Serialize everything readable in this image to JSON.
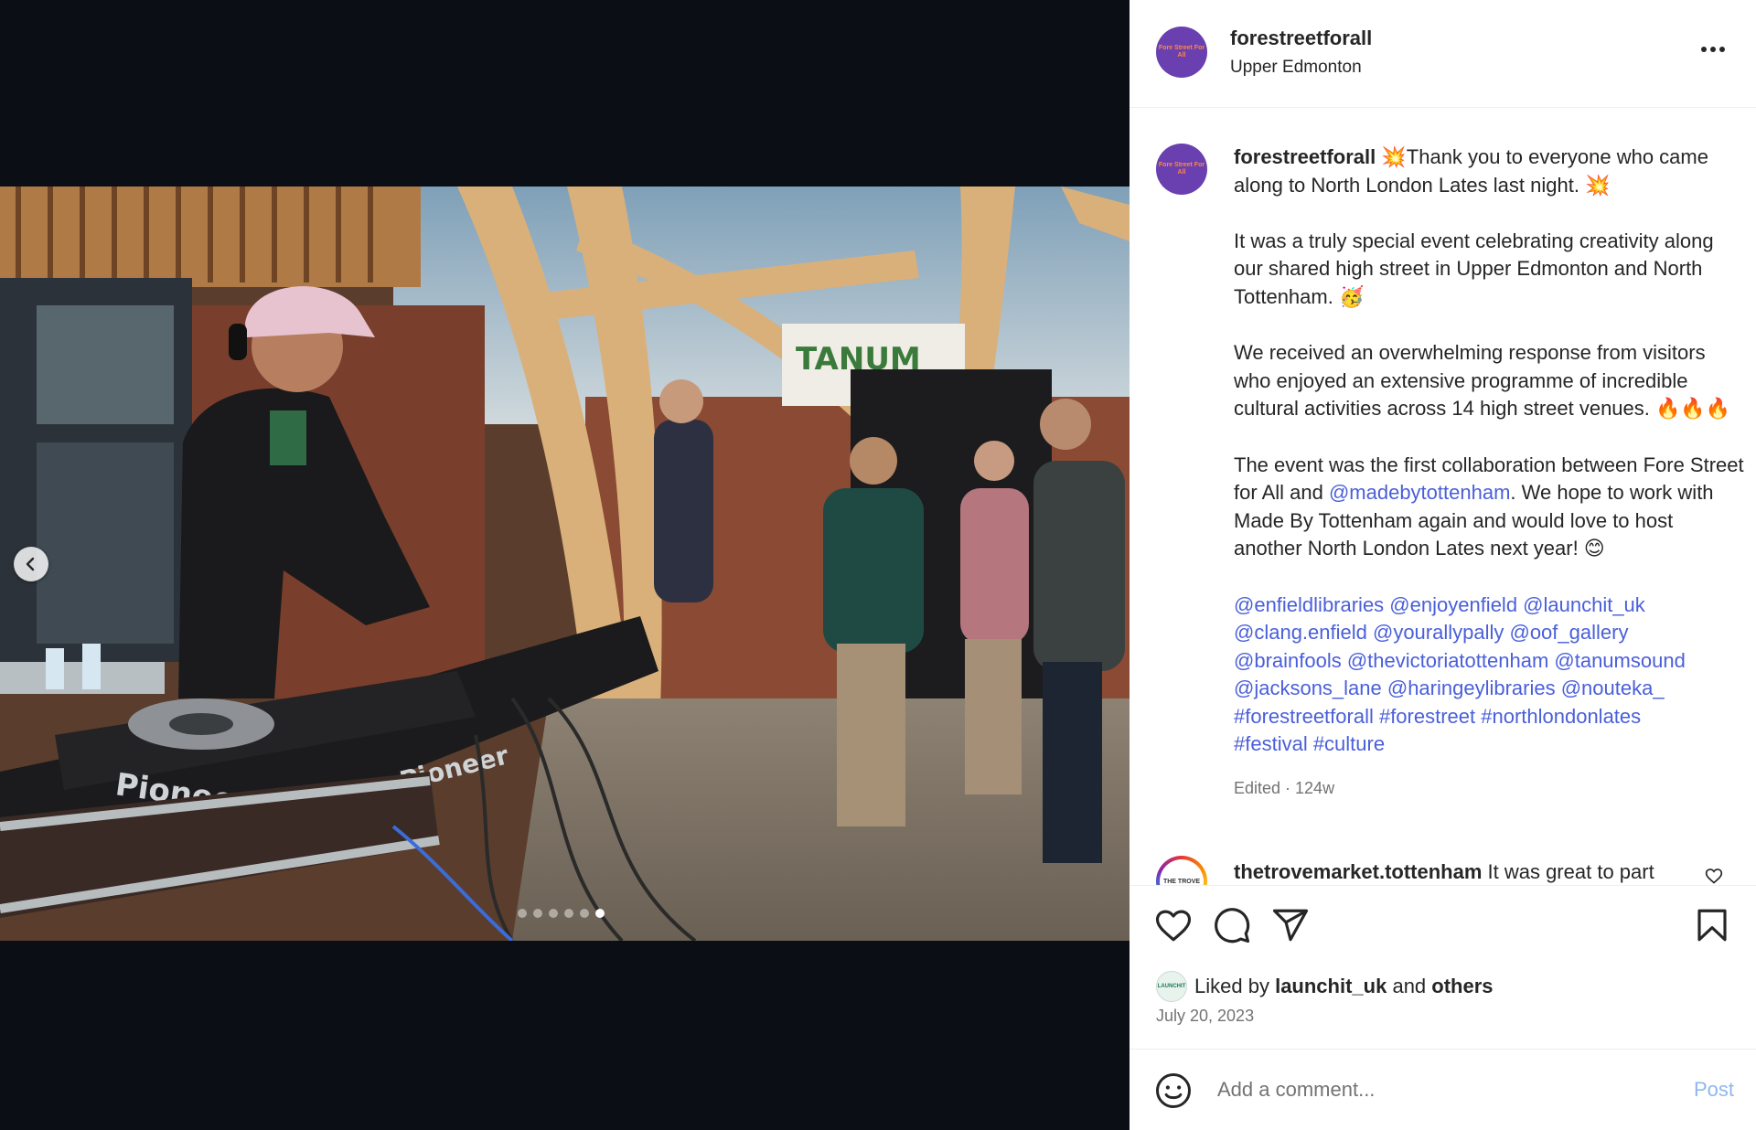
{
  "post": {
    "username": "forestreetforall",
    "location": "Upper Edmonton",
    "avatar_text": "Fore Street For All",
    "more_icon": "more-horizontal-icon"
  },
  "caption": {
    "username": "forestreetforall",
    "line1": " 💥Thank you to everyone who came along to North London Lates last night. 💥",
    "para2": "It was a truly special event celebrating creativity along our shared high street in Upper Edmonton and North Tottenham. 🥳",
    "para3": "We received an overwhelming response from visitors who enjoyed an extensive programme of incredible cultural activities across 14 high street venues. 🔥🔥🔥",
    "para4_a": "The event was the first collaboration between Fore Street for All and ",
    "para4_link": "@madebytottenham",
    "para4_b": ". We hope to work with Made By Tottenham again and would love to host another North London Lates next year! 😊",
    "tags_line1": "@enfieldlibraries @enjoyenfield @launchit_uk",
    "tags_line2": "@clang.enfield @yourallypally @oof_gallery",
    "tags_line3": "@brainfools @thevictoriatottenham @tanumsound",
    "tags_line4": "@jacksons_lane @haringeylibraries @nouteka_",
    "tags_line5": "#forestreetforall #forestreet #northlondonlates",
    "tags_line6": "#festival #culture",
    "meta": "Edited · 124w"
  },
  "comment": {
    "username": "thetrovemarket.tottenham",
    "text": " It was great to part",
    "avatar_text": "THE TROVE"
  },
  "actions": {
    "liked_prefix": "Liked by ",
    "liked_user": "launchit_uk",
    "liked_and": " and ",
    "liked_others": "others",
    "liker_avatar_text": "LAUNCHIT",
    "date": "July 20, 2023"
  },
  "add_comment": {
    "placeholder": "Add a comment...",
    "post_label": "Post"
  },
  "carousel": {
    "slide_count": 6,
    "active_index": 5
  },
  "colors": {
    "link": "#4a5fd9",
    "post_button_disabled": "#8fb7f2",
    "avatar_bg": "#6a3fb0"
  }
}
